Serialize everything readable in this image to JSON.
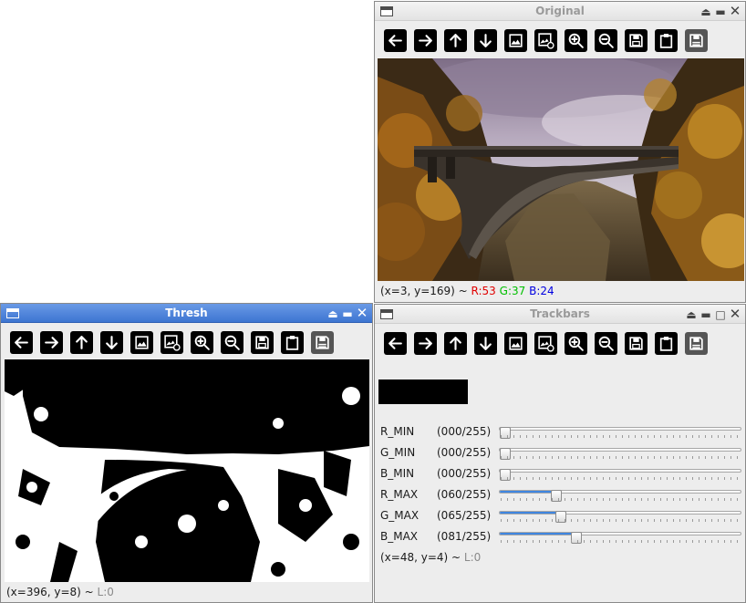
{
  "windows": {
    "original": {
      "title": "Original",
      "status": {
        "coords": "(x=3, y=169) ~ ",
        "r": "R:53",
        "g": "G:37",
        "b": "B:24"
      }
    },
    "thresh": {
      "title": "Thresh",
      "status": {
        "coords": "(x=396, y=8) ~ ",
        "lum": "L:0"
      }
    },
    "trackbars": {
      "title": "Trackbars",
      "status": {
        "coords": "(x=48, y=4) ~ ",
        "lum": "L:0"
      },
      "sliders": [
        {
          "label": "R_MIN",
          "value_text": "(000/255)",
          "value": 0
        },
        {
          "label": "G_MIN",
          "value_text": "(000/255)",
          "value": 0
        },
        {
          "label": "B_MIN",
          "value_text": "(000/255)",
          "value": 0
        },
        {
          "label": "R_MAX",
          "value_text": "(060/255)",
          "value": 60
        },
        {
          "label": "G_MAX",
          "value_text": "(065/255)",
          "value": 65
        },
        {
          "label": "B_MAX",
          "value_text": "(081/255)",
          "value": 81
        }
      ],
      "slider_max": 255
    }
  },
  "toolbar_icons": [
    "arrow-left-icon",
    "arrow-right-icon",
    "arrow-up-icon",
    "arrow-down-icon",
    "image-icon",
    "image-settings-icon",
    "zoom-in-icon",
    "zoom-out-icon",
    "save-icon",
    "clipboard-icon",
    "save-image-icon"
  ],
  "colors": {
    "accent": "#3f86e0",
    "active_title": "#3d75d1",
    "status_r": "#e00000",
    "status_g": "#00c000",
    "status_b": "#0000e0"
  }
}
